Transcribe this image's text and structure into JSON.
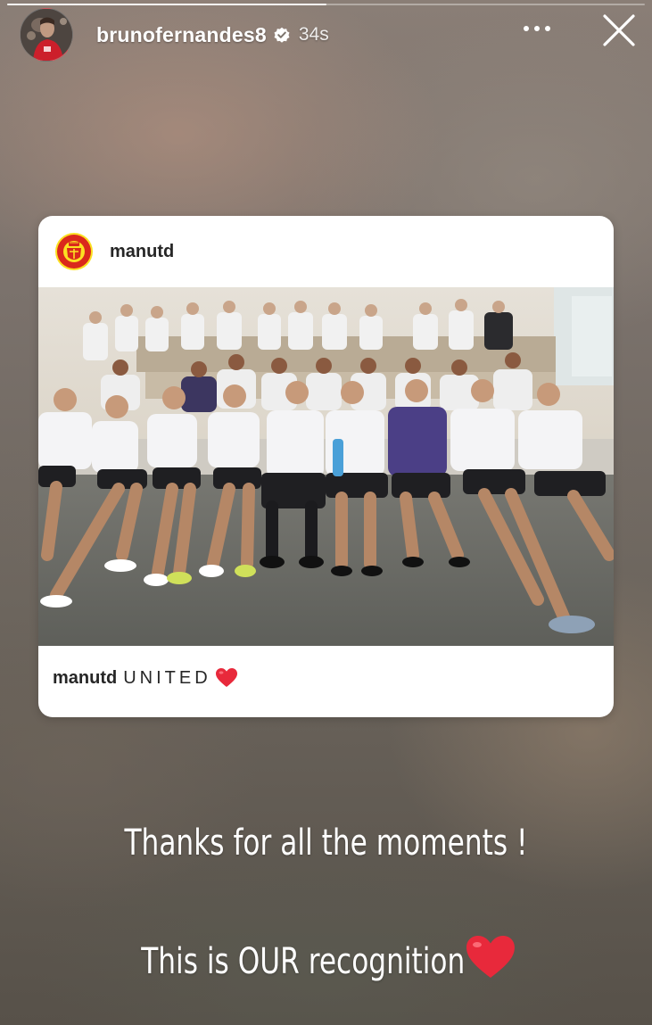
{
  "story": {
    "progress": 0.5,
    "username": "brunofernandes8",
    "verified_icon": "verified-badge-icon",
    "time_ago": "34s",
    "more_icon": "more-options-icon",
    "close_icon": "close-icon"
  },
  "shared_post": {
    "username": "manutd",
    "logo_icon": "manchester-united-crest-icon",
    "caption_user": "manutd",
    "caption_text": "UNITED",
    "caption_emoji": "red-heart-icon"
  },
  "overlay_text": {
    "line1": "Thanks for all the moments !",
    "line2": "This is OUR recognition",
    "line2_emoji": "red-heart-icon"
  },
  "colors": {
    "heart": "#e8293b",
    "verified": "#ffffff",
    "crest_red": "#da291c",
    "crest_gold": "#fbe122"
  }
}
